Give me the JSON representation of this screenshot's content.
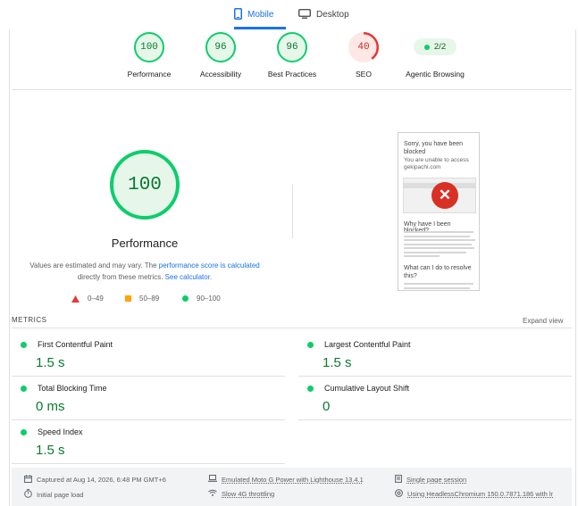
{
  "tabs": {
    "mobile": "Mobile",
    "desktop": "Desktop"
  },
  "categories": [
    {
      "score": "100",
      "label": "Performance",
      "status": "pass"
    },
    {
      "score": "96",
      "label": "Accessibility",
      "status": "pass"
    },
    {
      "score": "96",
      "label": "Best Practices",
      "status": "pass"
    },
    {
      "score": "40",
      "label": "SEO",
      "status": "fail"
    },
    {
      "score": "2/2",
      "label": "Agentic Browsing",
      "status": "pill"
    }
  ],
  "performance": {
    "score": "100",
    "title": "Performance",
    "note_pre": "Values are estimated and may vary. The ",
    "note_link1": "performance score is calculated",
    "note_mid": " directly from these metrics. ",
    "note_link2": "See calculator",
    "note_post": "."
  },
  "legend": [
    {
      "range": "0–49",
      "color": "#e53935",
      "shape": "triangle"
    },
    {
      "range": "50–89",
      "color": "#ffa400",
      "shape": "square"
    },
    {
      "range": "90–100",
      "color": "#0cce6b",
      "shape": "circle"
    }
  ],
  "thumbnail": {
    "heading": "Sorry, you have been blocked",
    "subheading": "You are unable to access gekipachi.com",
    "why": "Why have I been blocked?",
    "what": "What can I do to resolve this?"
  },
  "metrics": {
    "heading": "METRICS",
    "expand": "Expand view",
    "items": [
      {
        "name": "First Contentful Paint",
        "value": "1.5 s"
      },
      {
        "name": "Largest Contentful Paint",
        "value": "1.5 s"
      },
      {
        "name": "Total Blocking Time",
        "value": "0 ms"
      },
      {
        "name": "Cumulative Layout Shift",
        "value": "0"
      },
      {
        "name": "Speed Index",
        "value": "1.5 s"
      }
    ]
  },
  "footer": {
    "captured": "Captured at Aug 14, 2026, 6:48 PM GMT+6",
    "emulated": "Emulated Moto G Power with Lighthouse 13.4.1",
    "session": "Single page session",
    "load": "Initial page load",
    "throttling": "Slow 4G throttling",
    "browser": "Using HeadlessChromium 150.0.7871.186 with lr"
  },
  "colors": {
    "pass": "#0cce6b",
    "fail": "#e53935",
    "accent": "#1a73e8"
  }
}
